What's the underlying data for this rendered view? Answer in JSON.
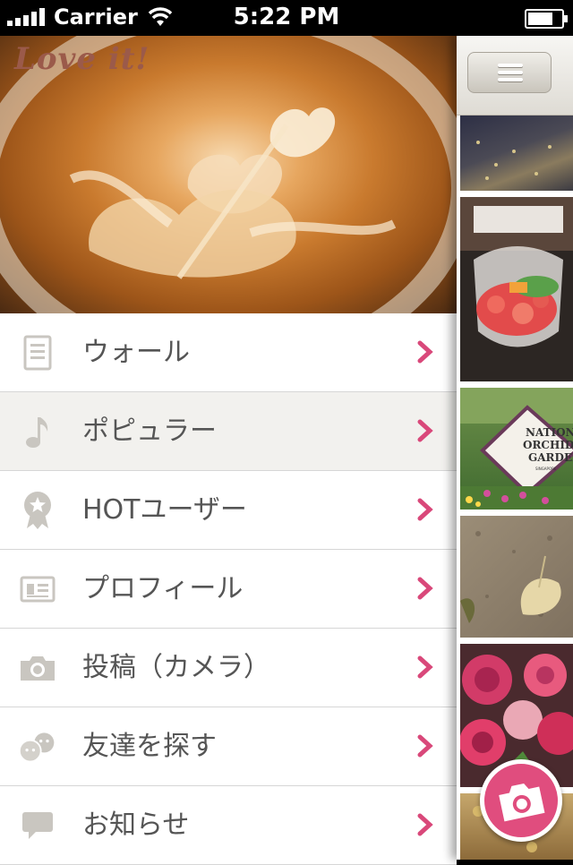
{
  "status_bar": {
    "carrier": "Carrier",
    "time": "5:22 PM",
    "battery_level": 0.85
  },
  "app": {
    "logo_text": "Love it!"
  },
  "menu": {
    "items": [
      {
        "label": "ウォール",
        "icon": "document-icon",
        "active": false
      },
      {
        "label": "ポピュラー",
        "icon": "music-note-icon",
        "active": true
      },
      {
        "label": "HOTユーザー",
        "icon": "award-ribbon-icon",
        "active": false
      },
      {
        "label": "プロフィール",
        "icon": "id-card-icon",
        "active": false
      },
      {
        "label": "投稿（カメラ）",
        "icon": "camera-icon",
        "active": false
      },
      {
        "label": "友達を探す",
        "icon": "friends-faces-icon",
        "active": false
      },
      {
        "label": "お知らせ",
        "icon": "speech-bubble-icon",
        "active": false
      }
    ]
  },
  "colors": {
    "accent": "#d9487a",
    "active_row": "#f2f1ee",
    "icon_gray": "#c9c6c0",
    "text": "#555555"
  },
  "feed": {
    "thumbnails": [
      "street-night-photo",
      "dessert-glass-photo",
      "national-orchid-garden-photo",
      "ginkgo-leaf-ground-photo",
      "pink-roses-photo",
      "autumn-leaves-photo"
    ],
    "sign_text": [
      "NATIONAL",
      "ORCHID",
      "GARDEN",
      "SINGAPORE"
    ]
  }
}
